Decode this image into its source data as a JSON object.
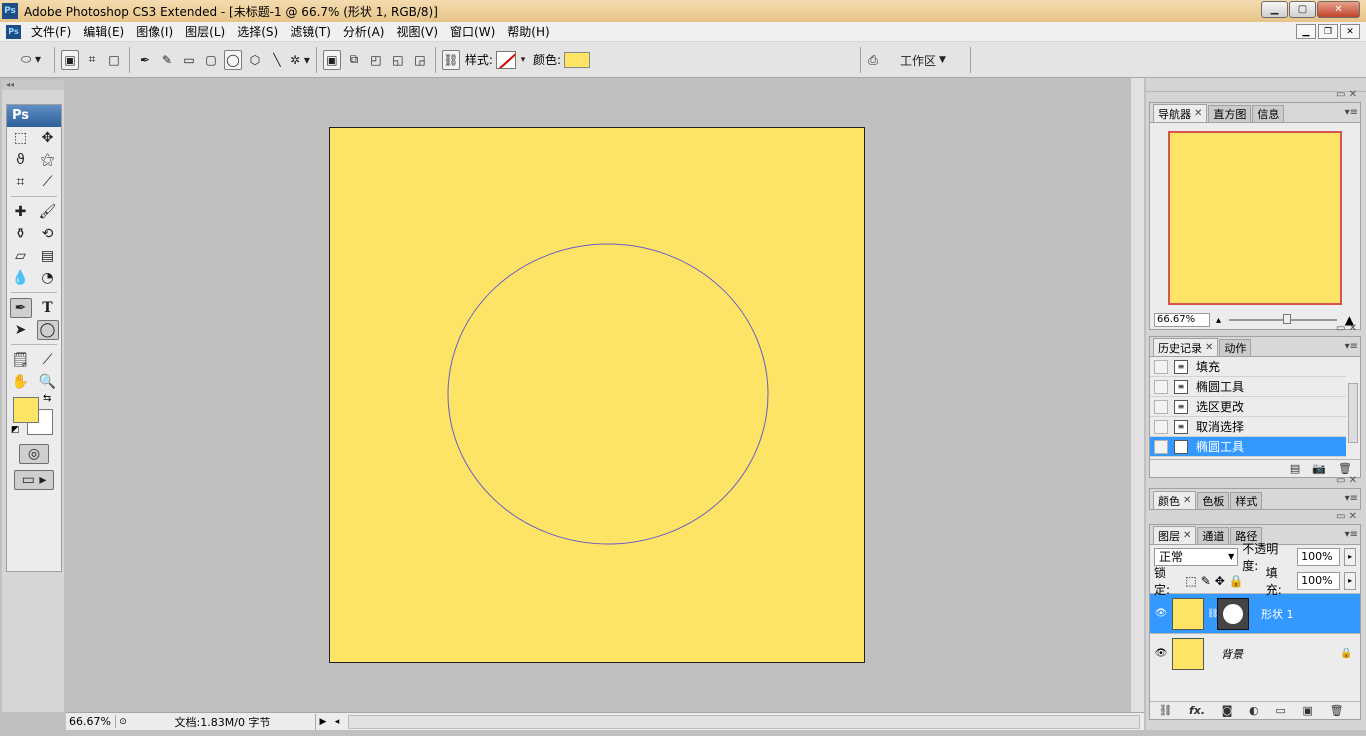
{
  "app": {
    "title": "Adobe Photoshop CS3 Extended - [未标题-1 @ 66.7% (形状 1, RGB/8)]",
    "logo": "Ps"
  },
  "window_controls": {
    "minimize": "▁",
    "maximize": "▢",
    "close": "✕"
  },
  "menu": {
    "items": [
      "文件(F)",
      "编辑(E)",
      "图像(I)",
      "图层(L)",
      "选择(S)",
      "滤镜(T)",
      "分析(A)",
      "视图(V)",
      "窗口(W)",
      "帮助(H)"
    ]
  },
  "options_bar": {
    "style_label": "样式:",
    "color_label": "颜色:",
    "color_value": "#fde466",
    "workspace_label": "工作区"
  },
  "toolbox": {
    "logo": "Ps",
    "foreground_color": "#fde466",
    "background_color": "#ffffff"
  },
  "document": {
    "fill_color": "#fde466",
    "ellipse_stroke": "#6b5cc8"
  },
  "status_bar": {
    "zoom": "66.67%",
    "doc_info": "文档:1.83M/0 字节"
  },
  "navigator": {
    "tabs": [
      "导航器",
      "直方图",
      "信息"
    ],
    "zoom": "66.67%"
  },
  "history": {
    "tabs": [
      "历史记录",
      "动作"
    ],
    "items": [
      "填充",
      "椭圆工具",
      "选区更改",
      "取消选择",
      "椭圆工具"
    ],
    "selected_index": 4
  },
  "color_panel": {
    "tabs": [
      "颜色",
      "色板",
      "样式"
    ]
  },
  "layers": {
    "tabs": [
      "图层",
      "通道",
      "路径"
    ],
    "blend_mode": "正常",
    "opacity_label": "不透明度:",
    "opacity_value": "100%",
    "lock_label": "锁定:",
    "fill_label": "填充:",
    "fill_value": "100%",
    "items": [
      {
        "name": "形状 1",
        "selected": true
      },
      {
        "name": "背景",
        "selected": false
      }
    ]
  }
}
